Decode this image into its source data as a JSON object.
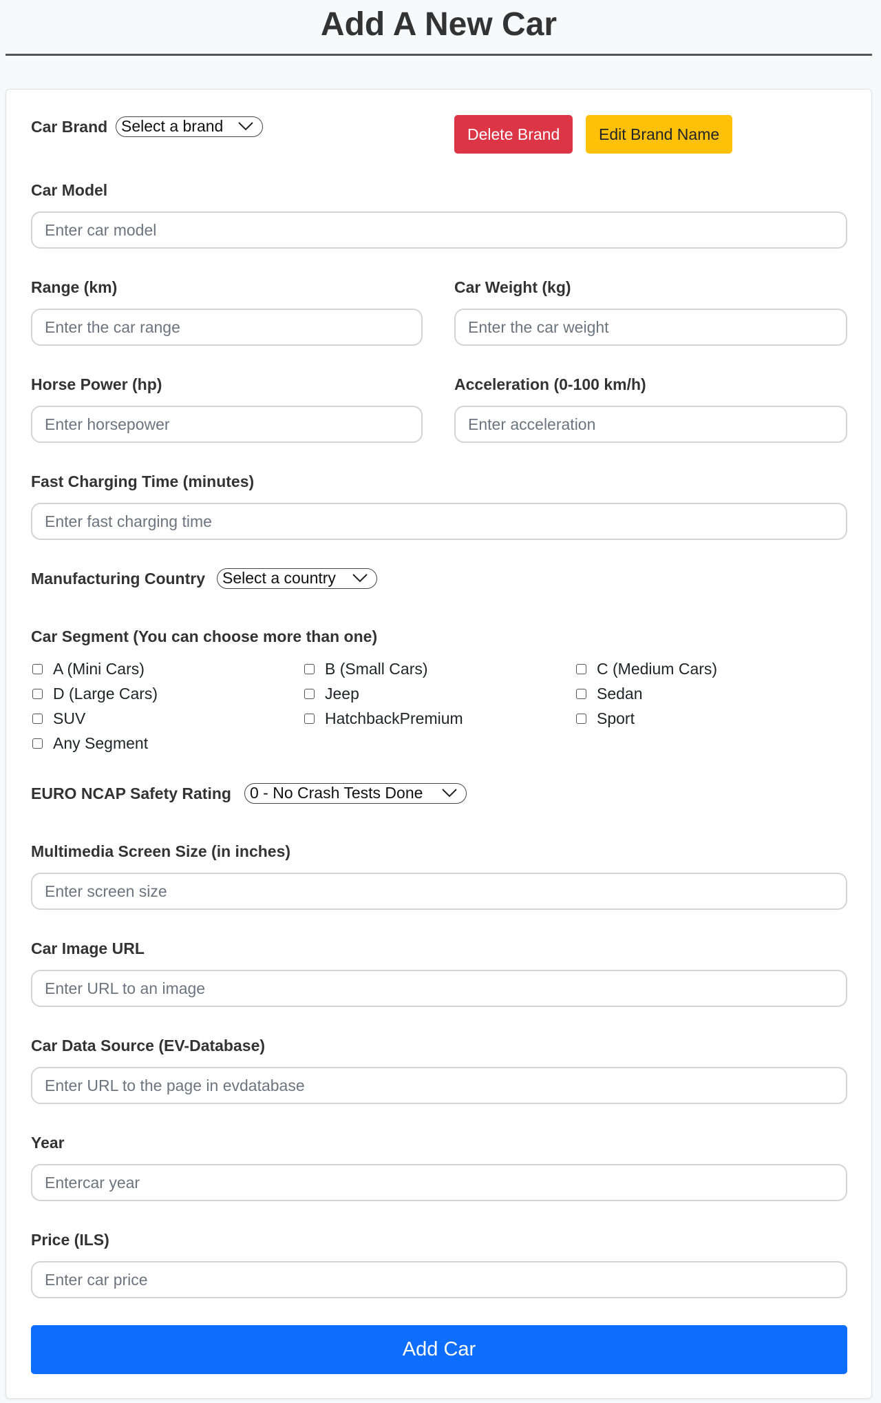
{
  "page": {
    "title": "Add A New Car"
  },
  "brand": {
    "label": "Car Brand",
    "selected": "Select a brand",
    "delete_label": "Delete Brand",
    "edit_label": "Edit Brand Name"
  },
  "fields": {
    "model": {
      "label": "Car Model",
      "placeholder": "Enter car model"
    },
    "range": {
      "label": "Range (km)",
      "placeholder": "Enter the car range"
    },
    "weight": {
      "label": "Car Weight (kg)",
      "placeholder": "Enter the car weight"
    },
    "horsepower": {
      "label": "Horse Power (hp)",
      "placeholder": "Enter horsepower"
    },
    "acceleration": {
      "label": "Acceleration (0-100 km/h)",
      "placeholder": "Enter acceleration"
    },
    "charging": {
      "label": "Fast Charging Time (minutes)",
      "placeholder": "Enter fast charging time"
    },
    "screen": {
      "label": "Multimedia Screen Size (in inches)",
      "placeholder": "Enter screen size"
    },
    "image_url": {
      "label": "Car Image URL",
      "placeholder": "Enter URL to an image"
    },
    "source": {
      "label": "Car Data Source (EV-Database)",
      "placeholder": "Enter URL to the page in evdatabase"
    },
    "year": {
      "label": "Year",
      "placeholder": "Entercar year"
    },
    "price": {
      "label": "Price (ILS)",
      "placeholder": "Enter car price"
    }
  },
  "country": {
    "label": "Manufacturing Country",
    "selected": "Select a country"
  },
  "segment": {
    "label": "Car Segment (You can choose more than one)",
    "options": [
      "A (Mini Cars)",
      "B (Small Cars)",
      "C (Medium Cars)",
      "D (Large Cars)",
      "Jeep",
      "Sedan",
      "SUV",
      "HatchbackPremium",
      "Sport",
      "Any Segment"
    ]
  },
  "safety": {
    "label": "EURO NCAP Safety Rating",
    "selected": "0 - No Crash Tests Done"
  },
  "submit": {
    "label": "Add Car"
  },
  "colors": {
    "danger": "#dc3545",
    "warning": "#ffc107",
    "primary": "#0d6efd"
  },
  "icons": {
    "dropdown": "chevron-down-icon"
  }
}
